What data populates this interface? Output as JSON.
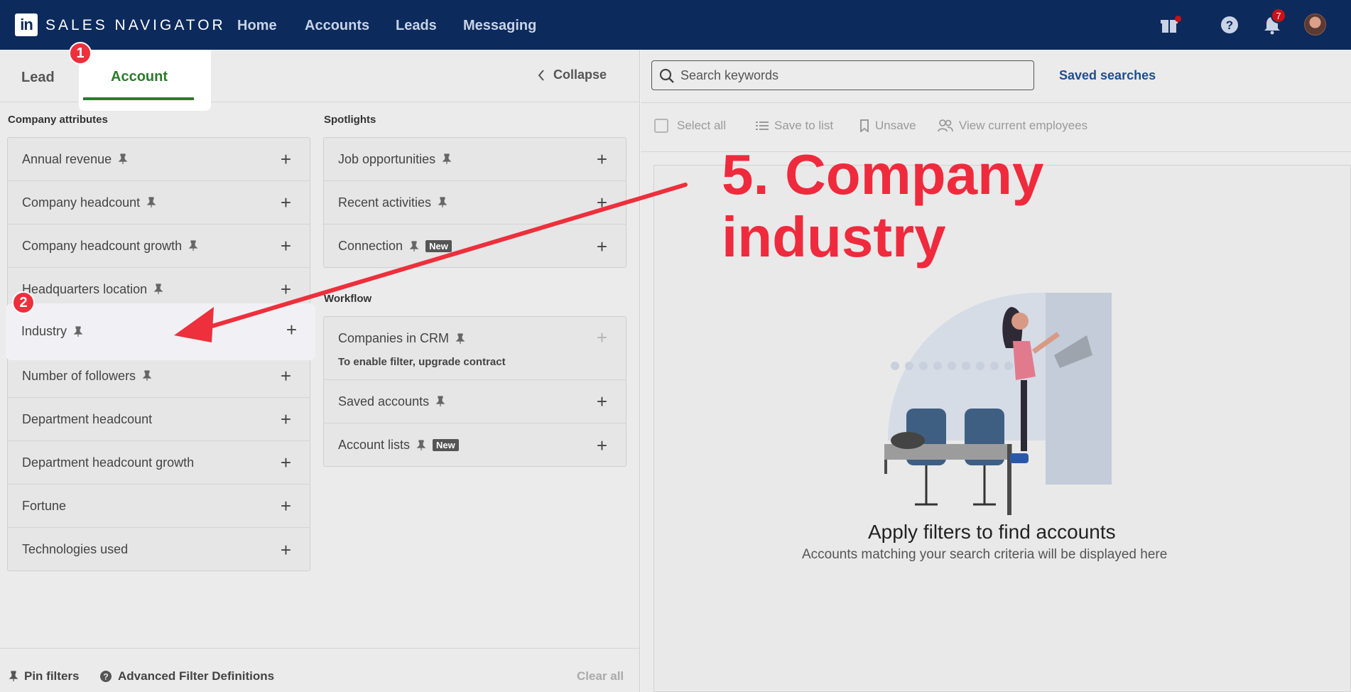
{
  "topnav": {
    "logo": "in",
    "brand": "SALES NAVIGATOR",
    "links": [
      "Home",
      "Accounts",
      "Leads",
      "Messaging"
    ],
    "notification_count": "7",
    "icons": [
      "gift-icon",
      "help-icon",
      "bell-icon",
      "avatar"
    ]
  },
  "tabs": {
    "lead": "Lead",
    "account": "Account",
    "collapse": "Collapse"
  },
  "company_attributes": {
    "title": "Company attributes",
    "items": [
      "Annual revenue",
      "Company headcount",
      "Company headcount growth",
      "Headquarters location",
      "Industry",
      "Number of followers",
      "Department headcount",
      "Department headcount growth",
      "Fortune",
      "Technologies used"
    ]
  },
  "spotlights": {
    "title": "Spotlights",
    "items": [
      "Job opportunities",
      "Recent activities",
      "Connection"
    ],
    "new_badge": "New"
  },
  "workflow": {
    "title": "Workflow",
    "items": [
      "Companies in CRM",
      "Saved accounts",
      "Account lists"
    ],
    "crm_note": "To enable filter, upgrade contract",
    "new_badge": "New"
  },
  "bottom": {
    "pin_filters": "Pin filters",
    "advanced": "Advanced Filter Definitions",
    "clear_all": "Clear all"
  },
  "search": {
    "placeholder": "Search keywords",
    "saved_searches": "Saved searches"
  },
  "toolbar": {
    "select_all": "Select all",
    "save_to_list": "Save to list",
    "unsave": "Unsave",
    "view_employees": "View current employees"
  },
  "empty_state": {
    "title": "Apply filters to find accounts",
    "subtitle": "Accounts matching your search criteria will be displayed here"
  },
  "annotations": {
    "step1": "1",
    "step2": "2",
    "callout_line1": "5. Company",
    "callout_line2": "industry",
    "color": "#f02a3d"
  },
  "colors": {
    "nav_bg": "#0c2a5c",
    "account_green": "#2b7a2b",
    "link_blue": "#1f4e8c"
  }
}
